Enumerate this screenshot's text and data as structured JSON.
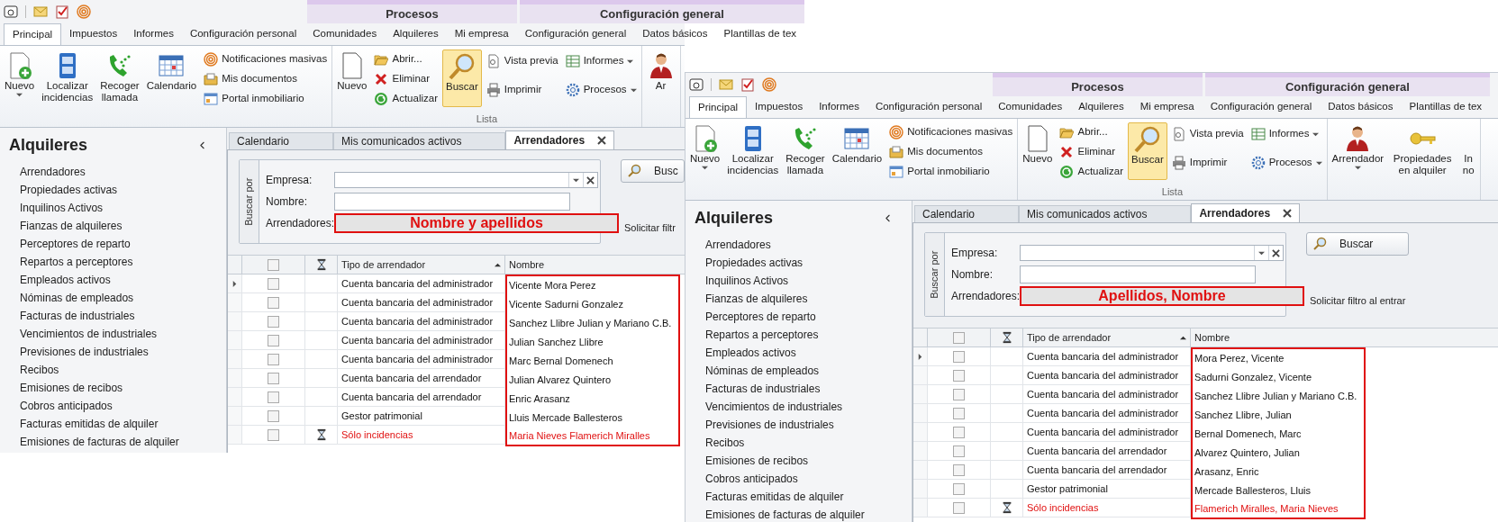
{
  "windows": [
    {
      "ribbon_tab_groups": [
        {
          "tabs": [
            {
              "label": "Principal",
              "selected": true
            },
            {
              "label": "Impuestos",
              "selected": false
            },
            {
              "label": "Informes",
              "selected": false
            },
            {
              "label": "Configuración personal",
              "selected": false
            }
          ]
        },
        {
          "context": "Procesos",
          "tabs": [
            {
              "label": "Comunidades",
              "selected": false
            },
            {
              "label": "Alquileres",
              "selected": false
            },
            {
              "label": "Mi empresa",
              "selected": false
            }
          ]
        },
        {
          "context": "Configuración general",
          "tabs": [
            {
              "label": "Configuración general",
              "selected": false
            },
            {
              "label": "Datos básicos",
              "selected": false
            },
            {
              "label": "Plantillas de tex",
              "selected": false
            }
          ]
        }
      ],
      "ribbon_groups": [
        {
          "items": [
            {
              "kind": "large",
              "label": "Nuevo",
              "dropdown": true,
              "pressed": false
            },
            {
              "kind": "large",
              "label": "Localizar incidencias",
              "dropdown": false,
              "pressed": false
            },
            {
              "kind": "large",
              "label": "Recoger llamada",
              "dropdown": false,
              "pressed": false
            },
            {
              "kind": "large",
              "label": "Calendario",
              "dropdown": false,
              "pressed": false
            },
            {
              "kind": "stack",
              "items": [
                {
                  "label": "Notificaciones masivas",
                  "dropdown": false
                },
                {
                  "label": "Mis documentos",
                  "dropdown": false
                },
                {
                  "label": "Portal inmobiliario",
                  "dropdown": false
                }
              ]
            }
          ]
        },
        {
          "label": "Lista",
          "items": [
            {
              "kind": "large",
              "label": "Nuevo",
              "dropdown": false,
              "pressed": false
            },
            {
              "kind": "stack",
              "items": [
                {
                  "label": "Abrir...",
                  "dropdown": false
                },
                {
                  "label": "Eliminar",
                  "dropdown": false
                },
                {
                  "label": "Actualizar",
                  "dropdown": false
                }
              ]
            },
            {
              "kind": "large",
              "label": "Buscar",
              "dropdown": false,
              "pressed": true
            },
            {
              "kind": "stack",
              "items": [
                {
                  "label": "Vista previa",
                  "dropdown": false
                },
                {
                  "label": "Imprimir",
                  "dropdown": false
                }
              ]
            },
            {
              "kind": "stack",
              "items": [
                {
                  "label": "Informes",
                  "dropdown": true
                },
                {
                  "label": "Procesos",
                  "dropdown": true
                }
              ]
            }
          ]
        },
        {
          "items": [
            {
              "kind": "large",
              "label": "Ar",
              "dropdown": false,
              "pressed": false
            }
          ]
        }
      ],
      "sidebar": {
        "title": "Alquileres",
        "items": [
          "Arrendadores",
          "Propiedades activas",
          "Inquilinos Activos",
          "Fianzas de alquileres",
          "Perceptores de reparto",
          "Repartos a perceptores",
          "Empleados activos",
          "Nóminas de empleados",
          "Facturas de industriales",
          "Vencimientos de industriales",
          "Previsiones de industriales",
          "Recibos",
          "Emisiones de recibos",
          "Cobros anticipados",
          "Facturas emitidas de alquiler",
          "Emisiones de facturas de alquiler"
        ]
      },
      "doc_tabs": [
        {
          "label": "Calendario",
          "selected": false
        },
        {
          "label": "Mis comunicados activos",
          "selected": false
        },
        {
          "label": "Arrendadores",
          "selected": true
        }
      ],
      "search_panel": {
        "legend": "Buscar por",
        "fields": [
          {
            "kind": "combo",
            "label": "Empresa:"
          },
          {
            "kind": "text",
            "label": "Nombre:"
          },
          {
            "kind": "highlight",
            "label": "Arrendadores:",
            "value": "Nombre y apellidos"
          }
        ],
        "button": "Busc",
        "option": "Solicitar filtr"
      },
      "grid": {
        "header_checked": false,
        "columns": [
          {
            "label": "Tipo de arrendador",
            "sort_ascending": true
          },
          {
            "label": "Nombre",
            "sort_ascending": false
          }
        ],
        "rows": [
          {
            "current": true,
            "checked": false,
            "incident": false,
            "type": "Cuenta bancaria del administrador",
            "name": "Vicente Mora Perez"
          },
          {
            "current": false,
            "checked": false,
            "incident": false,
            "type": "Cuenta bancaria del administrador",
            "name": "Vicente Sadurni Gonzalez"
          },
          {
            "current": false,
            "checked": false,
            "incident": false,
            "type": "Cuenta bancaria del administrador",
            "name": "Sanchez Llibre Julian y Mariano C.B."
          },
          {
            "current": false,
            "checked": false,
            "incident": false,
            "type": "Cuenta bancaria del administrador",
            "name": "Julian Sanchez Llibre"
          },
          {
            "current": false,
            "checked": false,
            "incident": false,
            "type": "Cuenta bancaria del administrador",
            "name": "Marc Bernal Domenech"
          },
          {
            "current": false,
            "checked": false,
            "incident": false,
            "type": "Cuenta bancaria del arrendador",
            "name": "Julian Alvarez Quintero"
          },
          {
            "current": false,
            "checked": false,
            "incident": false,
            "type": "Cuenta bancaria del arrendador",
            "name": "Enric Arasanz"
          },
          {
            "current": false,
            "checked": false,
            "incident": false,
            "type": "Gestor patrimonial",
            "name": "Lluis Mercade Ballesteros"
          },
          {
            "current": false,
            "checked": false,
            "incident": true,
            "type": "Sólo incidencias",
            "name": "Maria Nieves Flamerich Miralles"
          }
        ]
      }
    },
    {
      "ribbon_tab_groups": [
        {
          "tabs": [
            {
              "label": "Principal",
              "selected": true
            },
            {
              "label": "Impuestos",
              "selected": false
            },
            {
              "label": "Informes",
              "selected": false
            },
            {
              "label": "Configuración personal",
              "selected": false
            }
          ]
        },
        {
          "context": "Procesos",
          "tabs": [
            {
              "label": "Comunidades",
              "selected": false
            },
            {
              "label": "Alquileres",
              "selected": false
            },
            {
              "label": "Mi empresa",
              "selected": false
            }
          ]
        },
        {
          "context": "Configuración general",
          "tabs": [
            {
              "label": "Configuración general",
              "selected": false
            },
            {
              "label": "Datos básicos",
              "selected": false
            },
            {
              "label": "Plantillas de tex",
              "selected": false
            }
          ]
        }
      ],
      "ribbon_groups": [
        {
          "items": [
            {
              "kind": "large",
              "label": "Nuevo",
              "dropdown": true,
              "pressed": false
            },
            {
              "kind": "large",
              "label": "Localizar incidencias",
              "dropdown": false,
              "pressed": false
            },
            {
              "kind": "large",
              "label": "Recoger llamada",
              "dropdown": false,
              "pressed": false
            },
            {
              "kind": "large",
              "label": "Calendario",
              "dropdown": false,
              "pressed": false
            },
            {
              "kind": "stack",
              "items": [
                {
                  "label": "Notificaciones masivas",
                  "dropdown": false
                },
                {
                  "label": "Mis documentos",
                  "dropdown": false
                },
                {
                  "label": "Portal inmobiliario",
                  "dropdown": false
                }
              ]
            }
          ]
        },
        {
          "label": "Lista",
          "items": [
            {
              "kind": "large",
              "label": "Nuevo",
              "dropdown": false,
              "pressed": false
            },
            {
              "kind": "stack",
              "items": [
                {
                  "label": "Abrir...",
                  "dropdown": false
                },
                {
                  "label": "Eliminar",
                  "dropdown": false
                },
                {
                  "label": "Actualizar",
                  "dropdown": false
                }
              ]
            },
            {
              "kind": "large",
              "label": "Buscar",
              "dropdown": false,
              "pressed": true
            },
            {
              "kind": "stack",
              "items": [
                {
                  "label": "Vista previa",
                  "dropdown": false
                },
                {
                  "label": "Imprimir",
                  "dropdown": false
                }
              ]
            },
            {
              "kind": "stack",
              "items": [
                {
                  "label": "Informes",
                  "dropdown": true
                },
                {
                  "label": "Procesos",
                  "dropdown": true
                }
              ]
            }
          ]
        },
        {
          "items": [
            {
              "kind": "large",
              "label": "Arrendador",
              "dropdown": true,
              "pressed": false
            },
            {
              "kind": "large",
              "label": "Propiedades en alquiler",
              "dropdown": false,
              "pressed": false
            },
            {
              "kind": "large",
              "label": "In no",
              "dropdown": false,
              "pressed": false
            }
          ]
        }
      ],
      "sidebar": {
        "title": "Alquileres",
        "items": [
          "Arrendadores",
          "Propiedades activas",
          "Inquilinos Activos",
          "Fianzas de alquileres",
          "Perceptores de reparto",
          "Repartos a perceptores",
          "Empleados activos",
          "Nóminas de empleados",
          "Facturas de industriales",
          "Vencimientos de industriales",
          "Previsiones de industriales",
          "Recibos",
          "Emisiones de recibos",
          "Cobros anticipados",
          "Facturas emitidas de alquiler",
          "Emisiones de facturas de alquiler"
        ]
      },
      "doc_tabs": [
        {
          "label": "Calendario",
          "selected": false
        },
        {
          "label": "Mis comunicados activos",
          "selected": false
        },
        {
          "label": "Arrendadores",
          "selected": true
        }
      ],
      "search_panel": {
        "legend": "Buscar por",
        "fields": [
          {
            "kind": "combo",
            "label": "Empresa:"
          },
          {
            "kind": "text",
            "label": "Nombre:"
          },
          {
            "kind": "highlight",
            "label": "Arrendadores:",
            "value": "Apellidos, Nombre"
          }
        ],
        "button": "Buscar",
        "option": "Solicitar filtro al entrar"
      },
      "grid": {
        "header_checked": false,
        "columns": [
          {
            "label": "Tipo de arrendador",
            "sort_ascending": true
          },
          {
            "label": "Nombre",
            "sort_ascending": false
          }
        ],
        "rows": [
          {
            "current": true,
            "checked": false,
            "incident": false,
            "type": "Cuenta bancaria del administrador",
            "name": "Mora Perez, Vicente"
          },
          {
            "current": false,
            "checked": false,
            "incident": false,
            "type": "Cuenta bancaria del administrador",
            "name": "Sadurni Gonzalez, Vicente"
          },
          {
            "current": false,
            "checked": false,
            "incident": false,
            "type": "Cuenta bancaria del administrador",
            "name": "Sanchez Llibre Julian y Mariano C.B."
          },
          {
            "current": false,
            "checked": false,
            "incident": false,
            "type": "Cuenta bancaria del administrador",
            "name": "Sanchez Llibre, Julian"
          },
          {
            "current": false,
            "checked": false,
            "incident": false,
            "type": "Cuenta bancaria del administrador",
            "name": "Bernal Domenech, Marc"
          },
          {
            "current": false,
            "checked": false,
            "incident": false,
            "type": "Cuenta bancaria del arrendador",
            "name": "Alvarez Quintero, Julian"
          },
          {
            "current": false,
            "checked": false,
            "incident": false,
            "type": "Cuenta bancaria del arrendador",
            "name": "Arasanz, Enric"
          },
          {
            "current": false,
            "checked": false,
            "incident": false,
            "type": "Gestor patrimonial",
            "name": "Mercade Ballesteros, Lluis"
          },
          {
            "current": false,
            "checked": false,
            "incident": true,
            "type": "Sólo incidencias",
            "name": "Flamerich Miralles, Maria Nieves"
          }
        ]
      }
    }
  ]
}
